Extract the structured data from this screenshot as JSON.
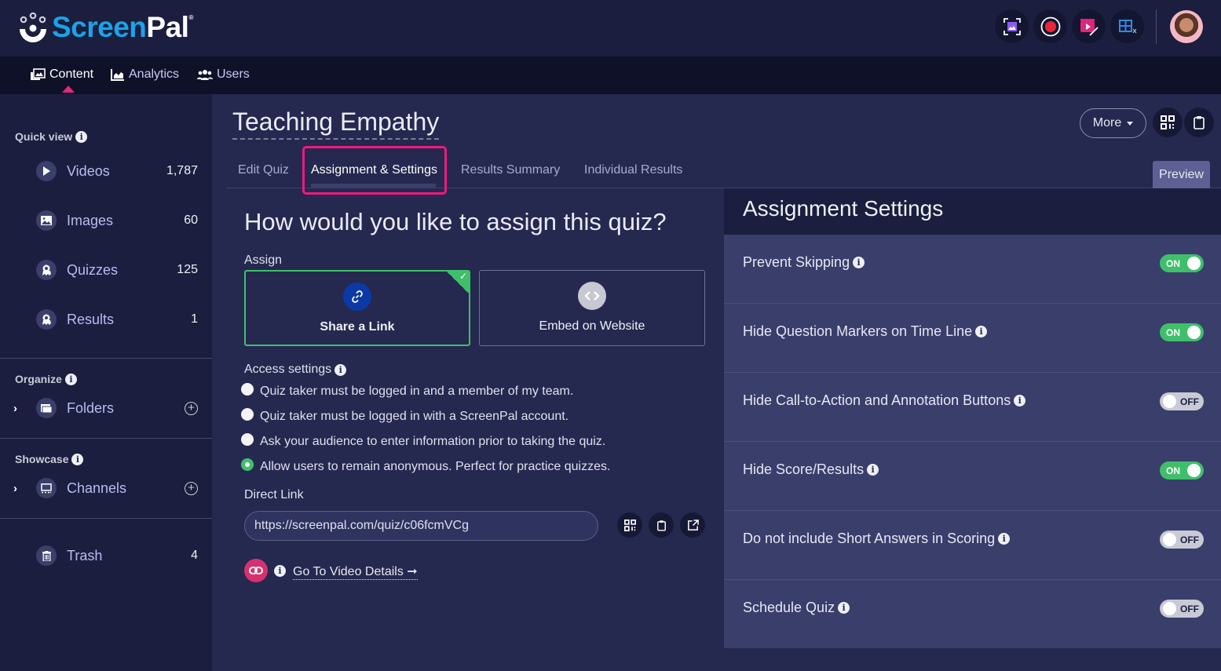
{
  "brand": {
    "name_part1": "Screen",
    "name_part2": "Pal",
    "registered": "®"
  },
  "header_tools": [
    {
      "name": "screenshot-tool-icon",
      "color": "#8c5cf0"
    },
    {
      "name": "record-icon",
      "color": "#e8263a"
    },
    {
      "name": "video-editor-icon",
      "color": "#e0257a"
    },
    {
      "name": "video-templates-icon",
      "color": "#2b8ce6"
    }
  ],
  "nav": {
    "items": [
      {
        "label": "Content",
        "icon": "content-icon",
        "active": true
      },
      {
        "label": "Analytics",
        "icon": "analytics-icon",
        "active": false
      },
      {
        "label": "Users",
        "icon": "users-icon",
        "active": false
      }
    ]
  },
  "sidebar": {
    "quick_view_title": "Quick view",
    "quick_view": [
      {
        "label": "Videos",
        "count": "1,787",
        "icon": "play-icon"
      },
      {
        "label": "Images",
        "count": "60",
        "icon": "image-icon"
      },
      {
        "label": "Quizzes",
        "count": "125",
        "icon": "award-icon"
      },
      {
        "label": "Results",
        "count": "1",
        "icon": "award-icon"
      }
    ],
    "organize_title": "Organize",
    "folders_label": "Folders",
    "showcase_title": "Showcase",
    "channels_label": "Channels",
    "trash_label": "Trash",
    "trash_count": "4"
  },
  "page": {
    "title": "Teaching Empathy",
    "more_label": "More",
    "preview_label": "Preview",
    "tabs": [
      {
        "label": "Edit Quiz",
        "active": false
      },
      {
        "label": "Assignment & Settings",
        "active": true
      },
      {
        "label": "Results Summary",
        "active": false
      },
      {
        "label": "Individual Results",
        "active": false
      }
    ]
  },
  "assign": {
    "question": "How would you like to assign this quiz?",
    "assign_label": "Assign",
    "options": [
      {
        "label": "Share a Link",
        "selected": true
      },
      {
        "label": "Embed on Website",
        "selected": false
      }
    ],
    "access_label": "Access settings",
    "access_options": [
      {
        "label": "Quiz taker must be logged in and a member of my team.",
        "checked": false
      },
      {
        "label": "Quiz taker must be logged in with a ScreenPal account.",
        "checked": false
      },
      {
        "label": "Ask your audience to enter information prior to taking the quiz.",
        "checked": false
      },
      {
        "label": "Allow users to remain anonymous. Perfect for practice quizzes.",
        "checked": true
      }
    ],
    "direct_link_label": "Direct Link",
    "direct_link_value": "https://screenpal.com/quiz/c06fcmVCg",
    "goto_label": "Go To Video Details ➞"
  },
  "settings": {
    "title": "Assignment Settings",
    "items": [
      {
        "label": "Prevent Skipping",
        "state": "ON"
      },
      {
        "label": "Hide Question Markers on Time Line",
        "state": "ON"
      },
      {
        "label": "Hide Call-to-Action and Annotation Buttons",
        "state": "OFF"
      },
      {
        "label": "Hide Score/Results",
        "state": "ON"
      },
      {
        "label": "Do not include Short Answers in Scoring",
        "state": "OFF"
      },
      {
        "label": "Schedule Quiz",
        "state": "OFF"
      }
    ]
  },
  "colors": {
    "accent_pink": "#f0197d",
    "toggle_on": "#3fbf6a",
    "brand_blue": "#1aa3e8"
  }
}
